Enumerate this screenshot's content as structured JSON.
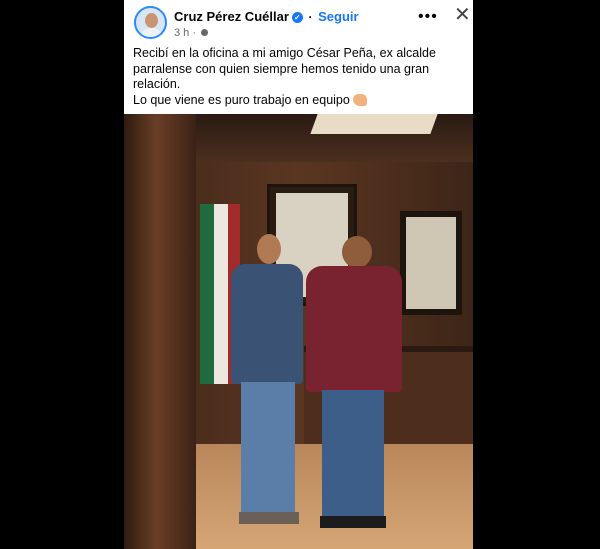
{
  "post": {
    "author": "Cruz Pérez Cuéllar",
    "separator": "·",
    "follow_label": "Seguir",
    "time": "3 h",
    "time_sep": "·",
    "more_icon": "more-options-icon",
    "close_icon": "close-icon",
    "text_line1": "Recibí en la oficina a mi amigo César Peña, ex alcalde parralense con quien siempre hemos tenido una gran relación.",
    "text_line2": "Lo que viene es puro trabajo en equipo",
    "emoji": "flexed-biceps-icon"
  },
  "colors": {
    "page_bg": "#000000",
    "card_bg": "#ffffff",
    "link": "#1877f2",
    "secondary_text": "#65676b"
  }
}
